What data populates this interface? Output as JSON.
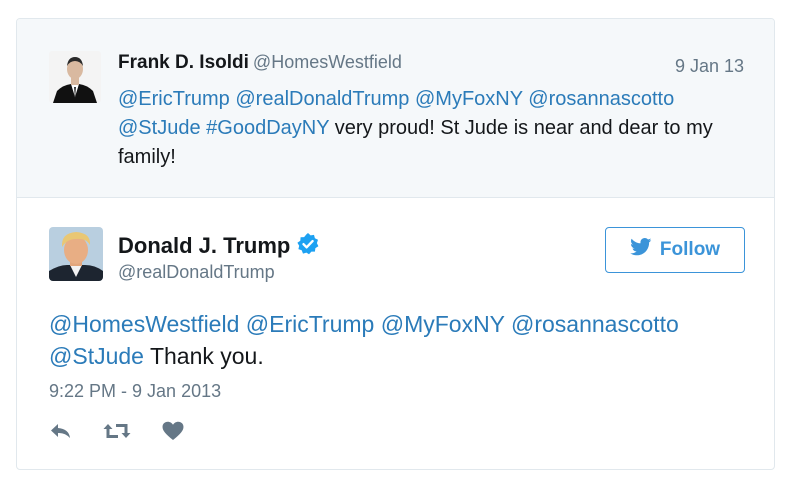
{
  "quoted_tweet": {
    "author_name": "Frank D. Isoldi",
    "author_handle": "@HomesWestfield",
    "date": "9 Jan 13",
    "text_parts": [
      {
        "text": "@EricTrump",
        "link": true
      },
      {
        "text": " ",
        "link": false
      },
      {
        "text": "@realDonaldTrump",
        "link": true
      },
      {
        "text": " ",
        "link": false
      },
      {
        "text": "@MyFoxNY",
        "link": true
      },
      {
        "text": " ",
        "link": false
      },
      {
        "text": "@rosannascotto",
        "link": true
      },
      {
        "text": " ",
        "link": false
      },
      {
        "text": "@StJude",
        "link": true
      },
      {
        "text": " ",
        "link": false
      },
      {
        "text": "#GoodDayNY",
        "link": true
      },
      {
        "text": " very proud! St Jude is near and dear to my family!",
        "link": false
      }
    ]
  },
  "main_tweet": {
    "author_name": "Donald J. Trump",
    "author_handle": "@realDonaldTrump",
    "verified_icon": "verified-badge-icon",
    "follow_label": "Follow",
    "text_parts": [
      {
        "text": "@HomesWestfield",
        "link": true
      },
      {
        "text": " ",
        "link": false
      },
      {
        "text": "@EricTrump",
        "link": true
      },
      {
        "text": " ",
        "link": false
      },
      {
        "text": "@MyFoxNY",
        "link": true
      },
      {
        "text": " ",
        "link": false
      },
      {
        "text": "@rosannascotto",
        "link": true
      },
      {
        "text": " ",
        "link": false
      },
      {
        "text": "@StJude",
        "link": true
      },
      {
        "text": " Thank you.",
        "link": false
      }
    ],
    "timestamp": "9:22 PM - 9 Jan 2013",
    "actions": [
      "reply-icon",
      "retweet-icon",
      "like-icon"
    ]
  },
  "colors": {
    "link": "#2b7bb9",
    "follow": "#3b94d9",
    "secondary_text": "#657786",
    "quoted_bg": "#f5f8fa"
  }
}
